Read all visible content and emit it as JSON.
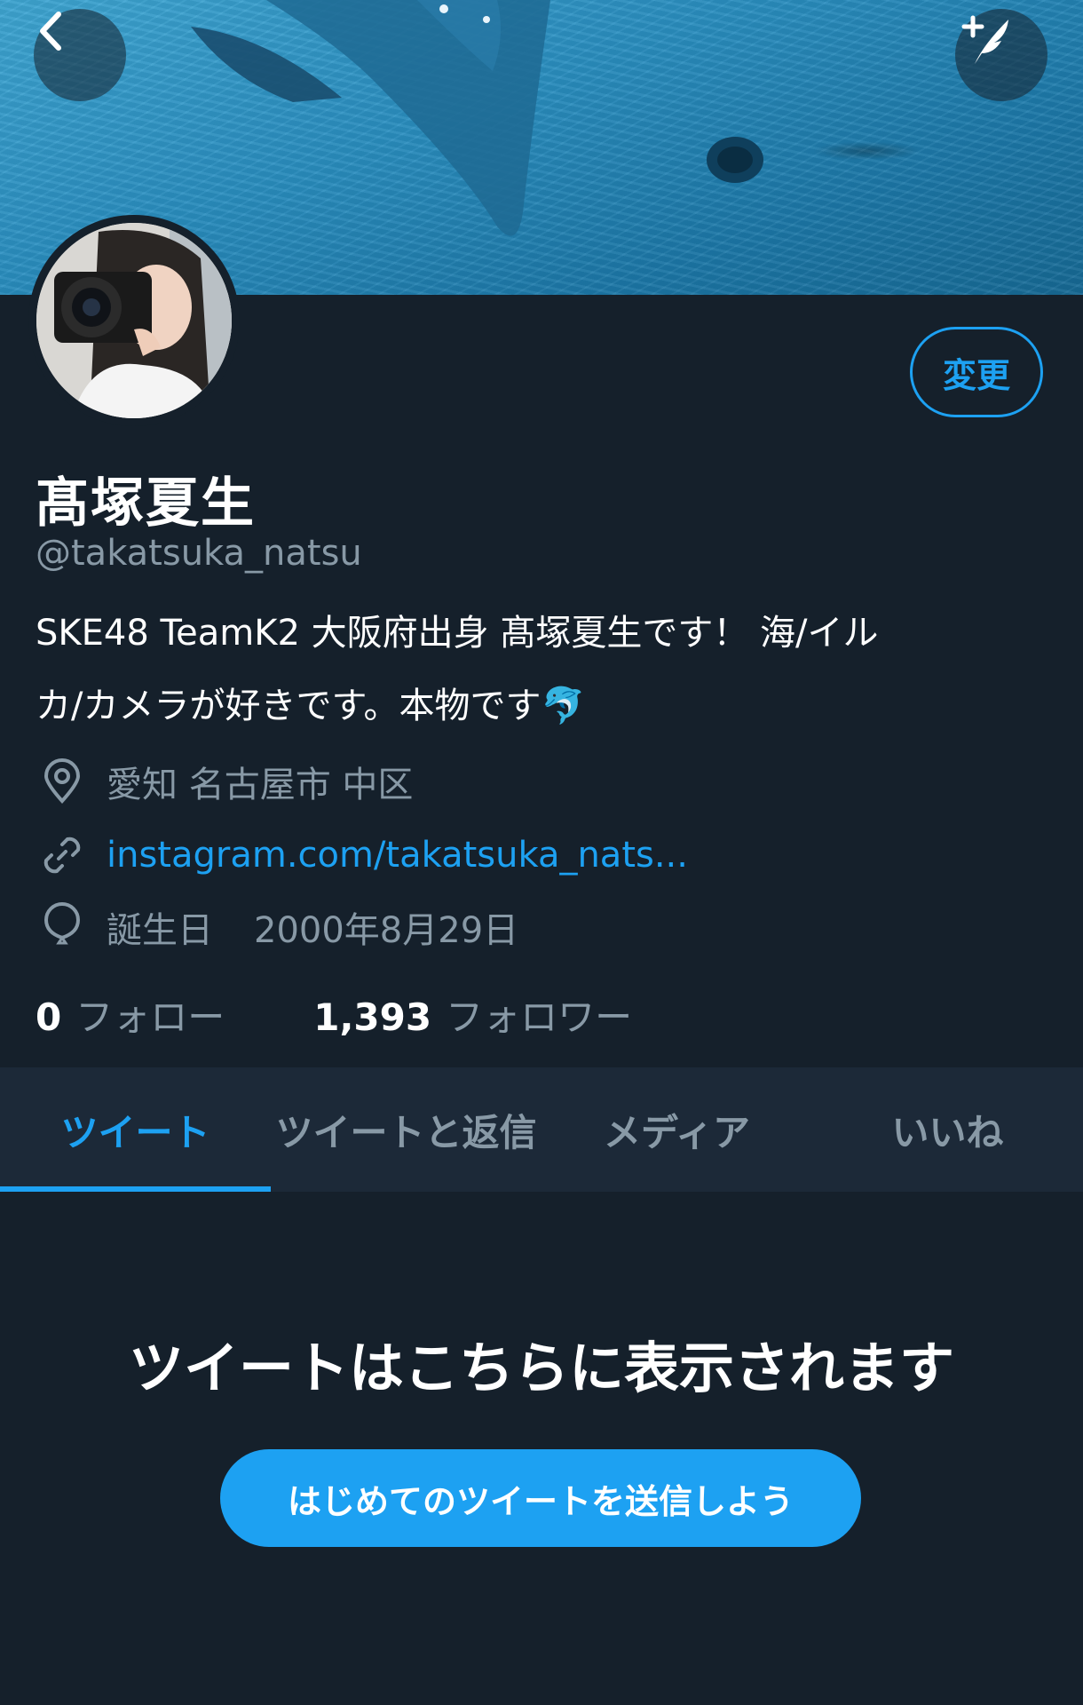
{
  "header": {
    "back_icon": "chevron-left-icon",
    "compose_icon": "compose-tweet-icon"
  },
  "profile": {
    "edit_label": "変更",
    "name": "髙塚夏生",
    "handle": "@takatsuka_natsu",
    "bio_line1": "SKE48 TeamK2 大阪府出身 髙塚夏生です！ 海/イル",
    "bio_line2": "カ/カメラが好きです。本物です🐬",
    "location": "愛知 名古屋市 中区",
    "website": "instagram.com/takatsuka_nats...",
    "birthday_label": "誕生日",
    "birthday": "2000年8月29日",
    "following_count": "0",
    "following_label": "フォロー",
    "followers_count": "1,393",
    "followers_label": "フォロワー"
  },
  "tabs": [
    {
      "label": "ツイート",
      "active": true
    },
    {
      "label": "ツイートと返信",
      "active": false
    },
    {
      "label": "メディア",
      "active": false
    },
    {
      "label": "いいね",
      "active": false
    }
  ],
  "empty_state": {
    "title": "ツイートはこちらに表示されます",
    "button_label": "はじめてのツイートを送信しよう"
  },
  "colors": {
    "background": "#15202b",
    "tab_bar": "#1c2938",
    "accent": "#1da1f2",
    "secondary_text": "#8899a6"
  }
}
